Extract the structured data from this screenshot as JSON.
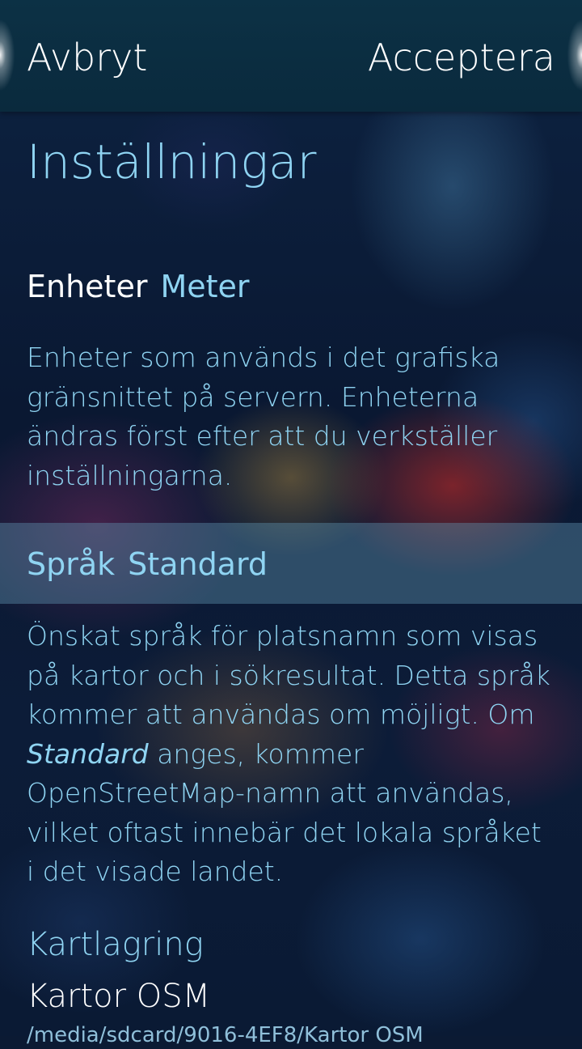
{
  "header": {
    "cancel_label": "Avbryt",
    "accept_label": "Acceptera"
  },
  "page": {
    "title": "Inställningar"
  },
  "units": {
    "label": "Enheter",
    "value": "Meter",
    "description": "Enheter som används i det grafiska gränsnittet på servern. Enheterna ändras först efter att du verkställer inställningarna."
  },
  "language": {
    "label": "Språk",
    "value": "Standard",
    "description_before": "Önskat språk för platsnamn som visas på kartor och i sökresultat. Detta språk kommer att användas om möjligt. Om ",
    "description_emph": "Standard",
    "description_after": " anges, kommer OpenStreetMap-namn att användas, vilket oftast innebär det lokala språket i det visade landet."
  },
  "map_storage": {
    "section_title": "Kartlagring",
    "item_label": "Kartor OSM",
    "item_path": "/media/sdcard/9016-4EF8/Kartor OSM"
  },
  "colors": {
    "highlight": "#8fd4f2",
    "primary_text": "#ffffff",
    "header_bg": "#0c3145",
    "selected_row_bg": "#6094b0"
  }
}
